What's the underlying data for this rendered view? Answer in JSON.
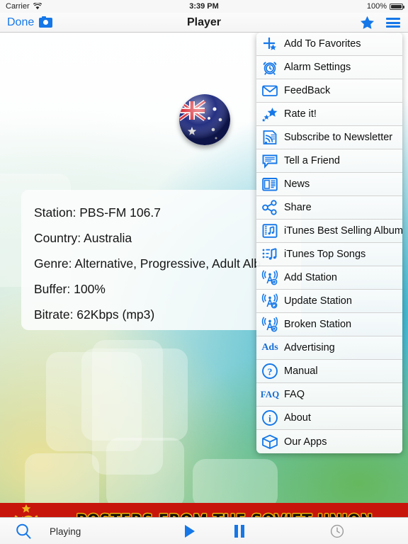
{
  "status_bar": {
    "carrier": "Carrier",
    "wifi_icon": "wifi-icon",
    "time": "3:39 PM",
    "battery_percent": "100%",
    "battery_icon": "battery-full-icon"
  },
  "nav_bar": {
    "done_label": "Done",
    "camera_icon": "camera-icon",
    "title": "Player",
    "favorites_icon": "star-icon",
    "menu_icon": "hamburger-menu-icon"
  },
  "player": {
    "flag_icon": "australia-flag-globe-icon",
    "info": [
      {
        "label": "Station",
        "value": "PBS-FM 106.7",
        "text": "Station: PBS-FM 106.7"
      },
      {
        "label": "Country",
        "value": "Australia",
        "text": "Country: Australia"
      },
      {
        "label": "Genre",
        "value": "Alternative, Progressive, Adult Alb",
        "text": "Genre: Alternative, Progressive, Adult Alb"
      },
      {
        "label": "Buffer",
        "value": "100%",
        "text": "Buffer: 100%"
      },
      {
        "label": "Bitrate",
        "value": "62Kbps (mp3)",
        "text": "Bitrate: 62Kbps (mp3)"
      }
    ]
  },
  "menu": {
    "items": [
      {
        "label": "Add To Favorites",
        "icon": "add-to-favorites-icon"
      },
      {
        "label": "Alarm Settings",
        "icon": "alarm-clock-icon"
      },
      {
        "label": "FeedBack",
        "icon": "envelope-icon"
      },
      {
        "label": "Rate it!",
        "icon": "stars-icon"
      },
      {
        "label": "Subscribe to Newsletter",
        "icon": "rss-document-icon"
      },
      {
        "label": "Tell a Friend",
        "icon": "chat-bubble-icon"
      },
      {
        "label": "News",
        "icon": "newspaper-icon"
      },
      {
        "label": "Share",
        "icon": "share-nodes-icon"
      },
      {
        "label": "iTunes Best Selling Albums",
        "icon": "album-music-icon"
      },
      {
        "label": "iTunes Top Songs",
        "icon": "song-list-icon"
      },
      {
        "label": "Add Station",
        "icon": "radio-tower-add-icon"
      },
      {
        "label": "Update Station",
        "icon": "radio-tower-update-icon"
      },
      {
        "label": "Broken Station",
        "icon": "radio-tower-broken-icon"
      },
      {
        "label": "Advertising",
        "icon": "ads-text-icon"
      },
      {
        "label": "Manual",
        "icon": "question-circle-icon"
      },
      {
        "label": "FAQ",
        "icon": "faq-text-icon"
      },
      {
        "label": "About",
        "icon": "info-circle-icon"
      },
      {
        "label": "Our Apps",
        "icon": "box-icon"
      }
    ]
  },
  "ad_banner": {
    "title": "POSTERS FROM THE SOVIET UNION",
    "emblem_icon": "soviet-hammer-sickle-icon",
    "background_color": "#c7150b",
    "text_color": "#141008",
    "outline_color": "#f5b40a"
  },
  "toolbar": {
    "search_icon": "search-icon",
    "status_label": "Playing",
    "play_icon": "play-icon",
    "pause_icon": "pause-icon",
    "timer_icon": "clock-icon"
  },
  "colors": {
    "accent_blue": "#1577e8",
    "nav_background": "#f4f4f4",
    "disabled_gray": "#9a9a9a"
  }
}
